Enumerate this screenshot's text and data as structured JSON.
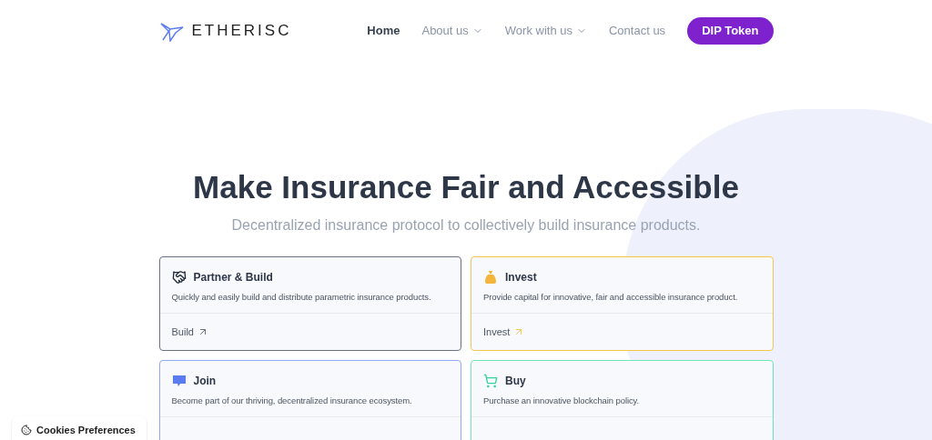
{
  "header": {
    "logo": "ETHERISC",
    "nav": [
      {
        "label": "Home",
        "selected": true,
        "dropdown": false
      },
      {
        "label": "About us",
        "selected": false,
        "dropdown": true
      },
      {
        "label": "Work with us",
        "selected": false,
        "dropdown": true
      },
      {
        "label": "Contact us",
        "selected": false,
        "dropdown": false
      }
    ],
    "cta": "DIP Token"
  },
  "hero": {
    "title": "Make Insurance Fair and Accessible",
    "subtitle": "Decentralized insurance protocol to collectively build insurance products."
  },
  "cards": [
    {
      "kind": "handshake",
      "title": "Partner & Build",
      "description": "Quickly and easily build and distribute parametric insurance products.",
      "link": "Build",
      "color": "#6b7280"
    },
    {
      "kind": "moneybag",
      "title": "Invest",
      "description": "Provide capital for innovative, fair and accessible insurance product.",
      "link": "Invest",
      "color": "#f5c451"
    },
    {
      "kind": "join",
      "title": "Join",
      "description": "Become part of our thriving, decentralized insurance ecosystem.",
      "color": "#93a9f5"
    },
    {
      "kind": "cart",
      "title": "Buy",
      "description": "Purchase an innovative blockchain policy.",
      "color": "#6ee7b7"
    }
  ],
  "cookies": "Cookies Preferences"
}
